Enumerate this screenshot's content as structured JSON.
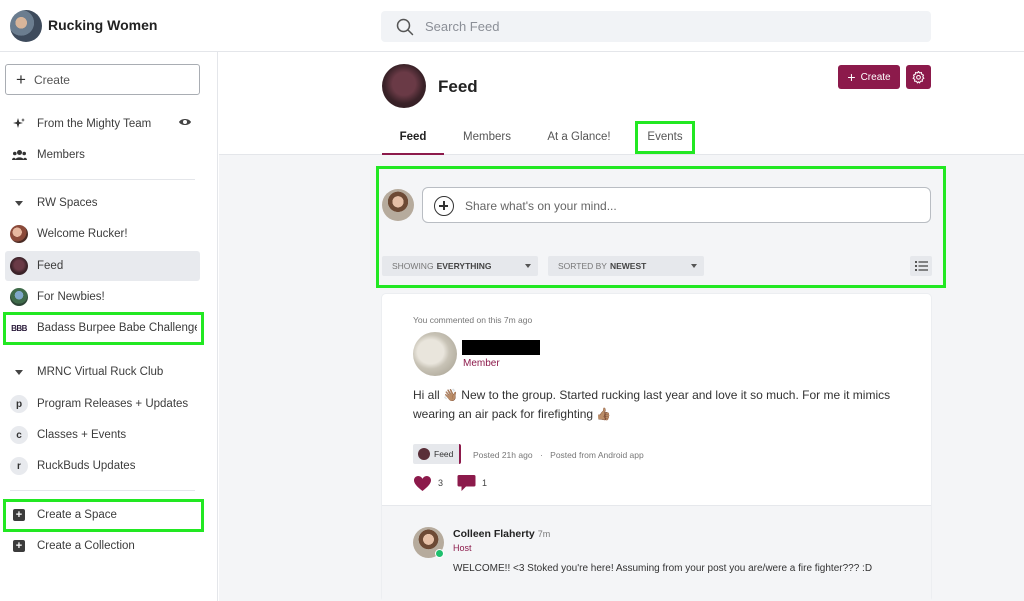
{
  "app": {
    "name": "Rucking Women"
  },
  "search": {
    "placeholder": "Search Feed"
  },
  "sidebar": {
    "create_label": "Create",
    "top_items": [
      {
        "label": "From the Mighty Team",
        "icon": "sparkle-icon"
      },
      {
        "label": "Members",
        "icon": "people-icon"
      }
    ],
    "sections": [
      {
        "title": "RW Spaces",
        "items": [
          {
            "label": "Welcome Rucker!",
            "icon": "space-avatar"
          },
          {
            "label": "Feed",
            "icon": "space-avatar",
            "active": true
          },
          {
            "label": "For Newbies!",
            "icon": "space-avatar"
          },
          {
            "label": "Badass Burpee Babe Challenge",
            "icon": "BBB"
          }
        ]
      },
      {
        "title": "MRNC Virtual Ruck Club",
        "items": [
          {
            "label": "Program Releases + Updates",
            "icon": "p"
          },
          {
            "label": "Classes + Events",
            "icon": "c"
          },
          {
            "label": "RuckBuds Updates",
            "icon": "r"
          }
        ]
      }
    ],
    "bottom_items": [
      {
        "label": "Create a Space"
      },
      {
        "label": "Create a Collection"
      }
    ]
  },
  "header": {
    "title": "Feed",
    "create_label": "Create",
    "tabs": [
      "Feed",
      "Members",
      "At a Glance!",
      "Events"
    ],
    "active_tab": "Feed"
  },
  "composer": {
    "placeholder": "Share what's on your mind...",
    "filter_show_prefix": "SHOWING",
    "filter_show_value": "EVERYTHING",
    "filter_sort_prefix": "SORTED BY",
    "filter_sort_value": "NEWEST"
  },
  "post": {
    "activity": "You commented on this 7m ago",
    "author_role": "Member",
    "body": "Hi all 👋🏽 New to the group. Started rucking last year and love it so much. For me it mimics wearing an air pack for firefighting 👍🏽",
    "tag": "Feed",
    "posted": "Posted 21h ago",
    "separator": "·",
    "source": "Posted from Android app",
    "likes": "3",
    "comments": "1"
  },
  "comment": {
    "name": "Colleen Flaherty",
    "time": "7m",
    "role": "Host",
    "text": "WELCOME!! <3 Stoked you're here! Assuming from your post you are/were a fire fighter??? :D"
  },
  "colors": {
    "accent": "#8c1a4b",
    "highlight": "#22e822",
    "online": "#1fbf6e"
  }
}
